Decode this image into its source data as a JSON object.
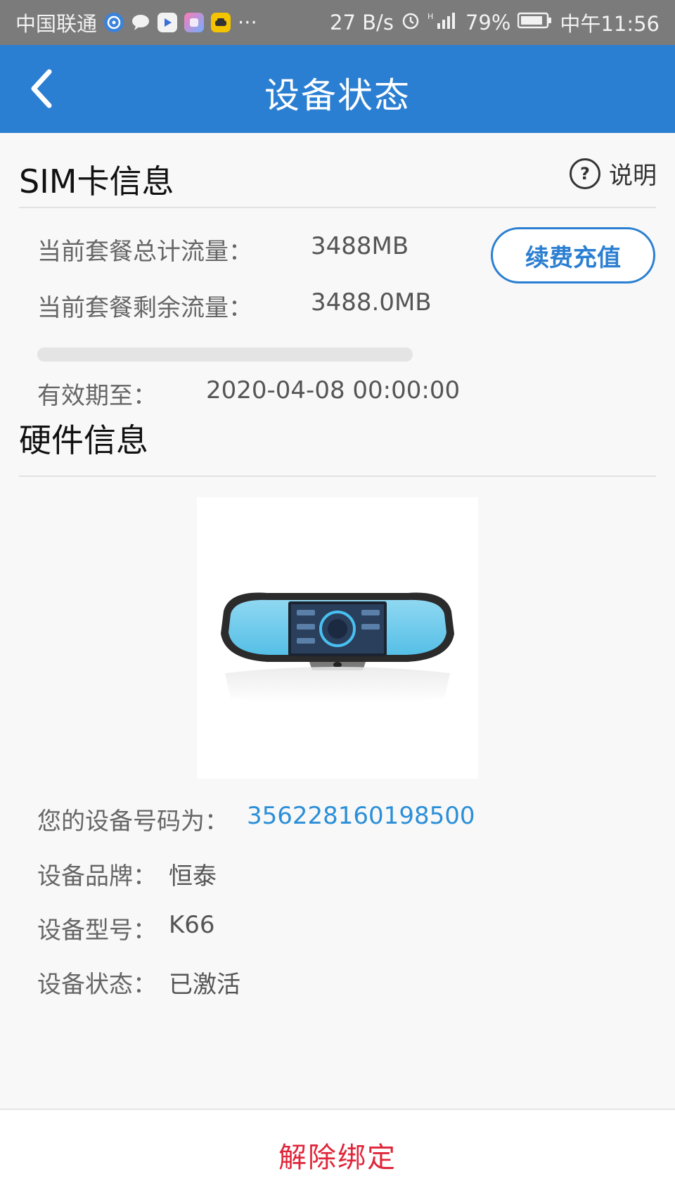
{
  "status_bar": {
    "carrier": "中国联通",
    "more": "···",
    "net_speed": "27 B/s",
    "battery": "79%",
    "time": "中午11:56"
  },
  "nav": {
    "title": "设备状态"
  },
  "sim": {
    "title": "SIM卡信息",
    "help_label": "说明",
    "help_symbol": "?",
    "total_label": "当前套餐总计流量：",
    "total_value": "3488MB",
    "remaining_label": "当前套餐剩余流量：",
    "remaining_value": "3488.0MB",
    "usage_fraction": 0,
    "expiry_label": "有效期至：",
    "expiry_value": "2020-04-08 00:00:00",
    "recharge_label": "续费充值"
  },
  "hardware": {
    "title": "硬件信息",
    "number_label": "您的设备号码为：",
    "number_value": "356228160198500",
    "brand_label": "设备品牌：",
    "brand_value": "恒泰",
    "model_label": "设备型号：",
    "model_value": "K66",
    "state_label": "设备状态：",
    "state_value": "已激活"
  },
  "footer": {
    "unbind_label": "解除绑定"
  },
  "colors": {
    "primary": "#2b7fd2",
    "danger": "#e0263a",
    "link": "#2b8fd8"
  }
}
